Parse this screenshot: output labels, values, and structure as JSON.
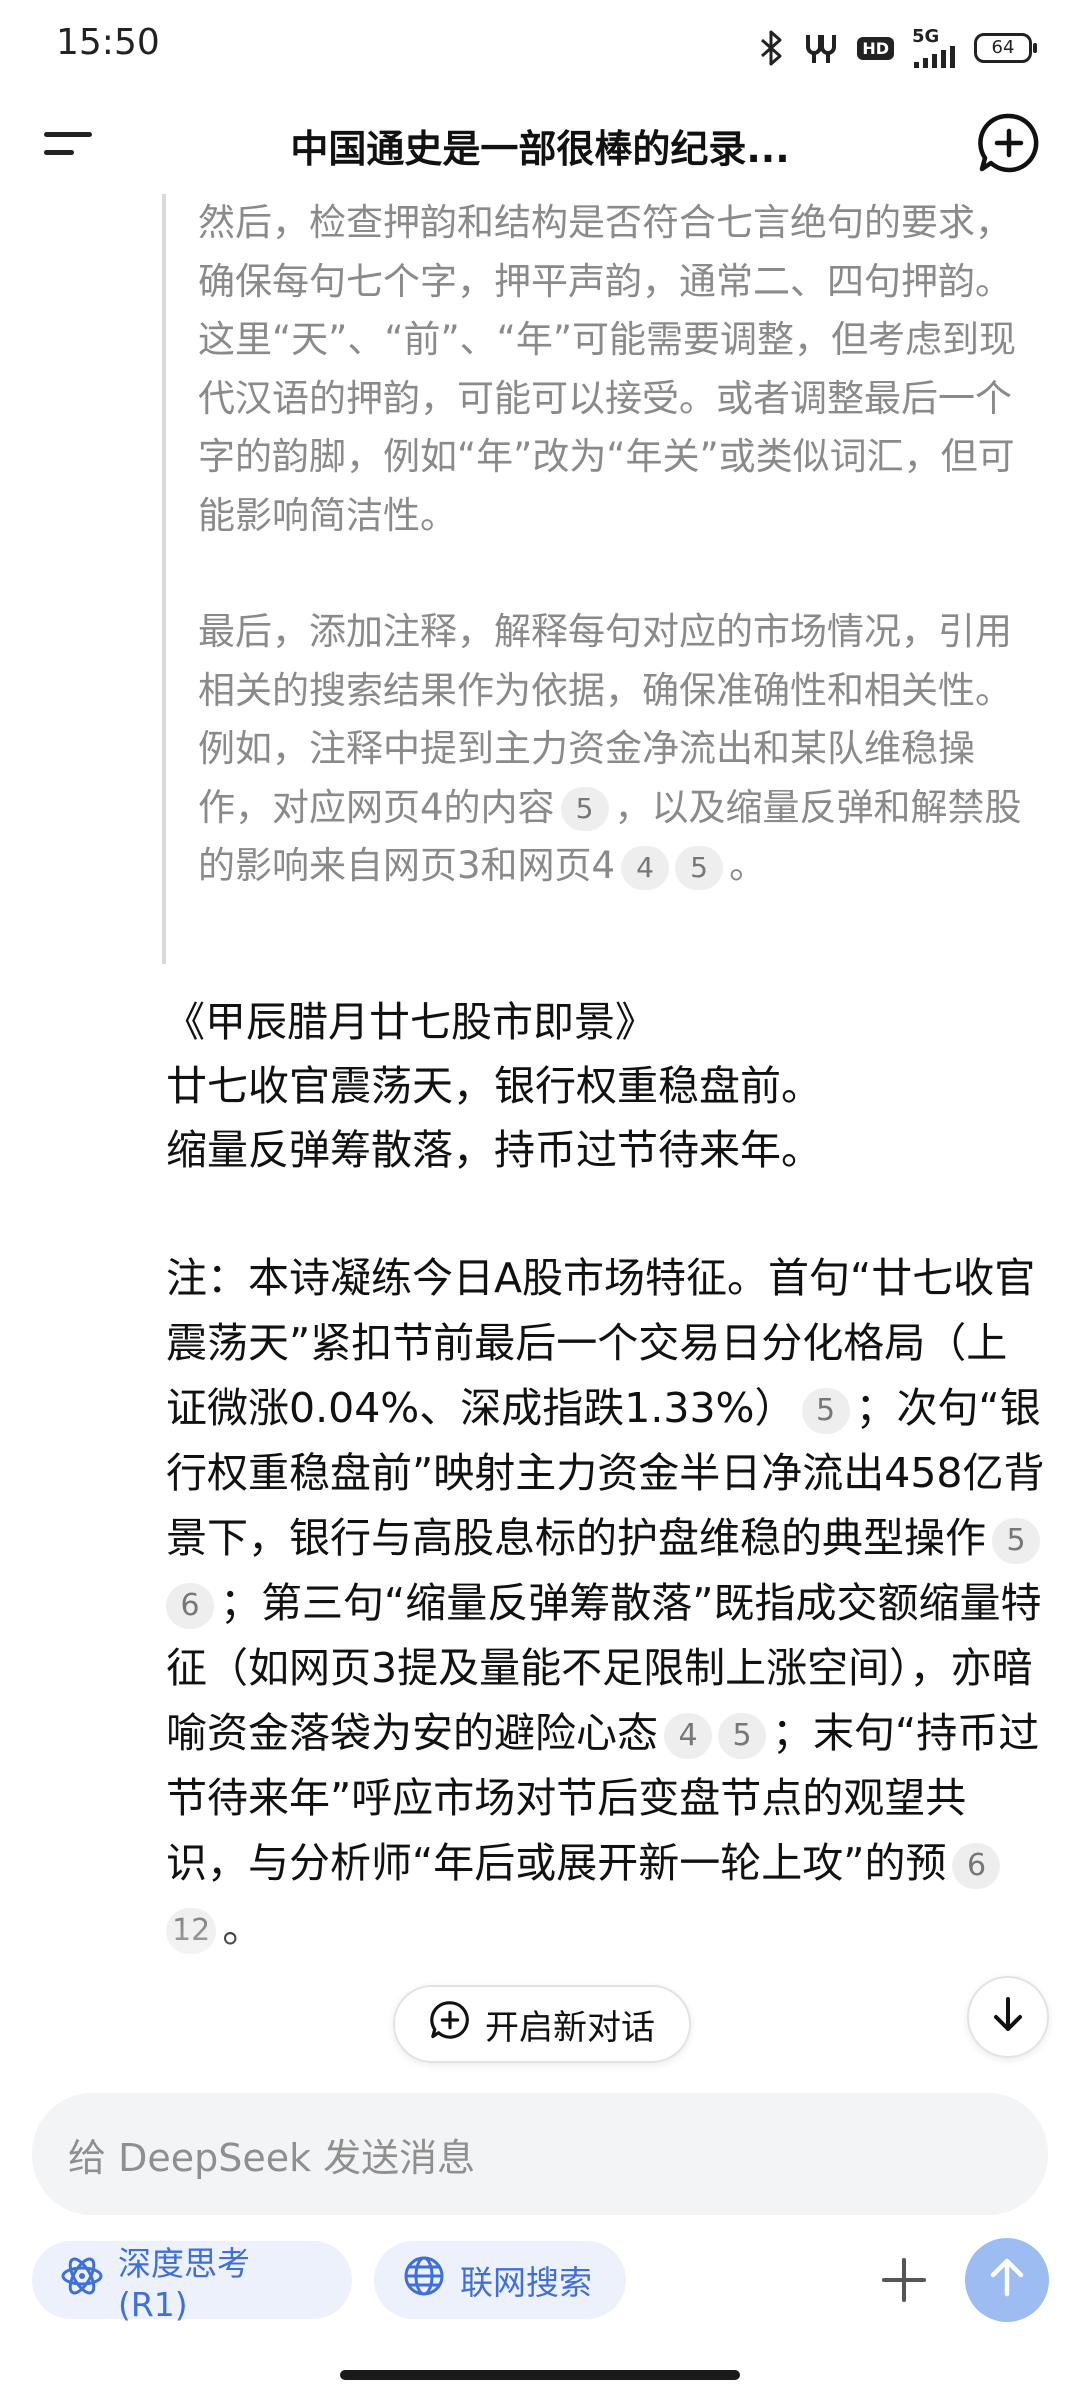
{
  "status_bar": {
    "time": "15:50",
    "hd_label": "HD",
    "network_label": "5G",
    "battery_level": "64",
    "icons": [
      "bluetooth-icon",
      "signal-sound-icon",
      "hd-icon",
      "cellular-signal-icon",
      "battery-icon"
    ]
  },
  "header": {
    "title": "中国通史是一部很棒的纪录...",
    "menu_icon": "menu-icon",
    "new_chat_icon": "add-chat-icon"
  },
  "thinking": {
    "p1": "然后，检查押韵和结构是否符合七言绝句的要求，确保每句七个字，押平声韵，通常二、四句押韵。这里“天”、“前”、“年”可能需要调整，但考虑到现代汉语的押韵，可能可以接受。或者调整最后一个字的韵脚，例如“年”改为“年关”或类似词汇，但可能影响简洁性。",
    "p2_a": "最后，添加注释，解释每句对应的市场情况，引用相关的搜索结果作为依据，确保准确性和相关性。例如，注释中提到主力资金净流出和某队维稳操作，对应网页4的内容",
    "p2_cite1": "5",
    "p2_b": "，以及缩量反弹和解禁股的影响来自网页3和网页4",
    "p2_cite2": "4",
    "p2_cite3": "5",
    "p2_c": "。"
  },
  "answer": {
    "poem_title": "《甲辰腊月廿七股市即景》",
    "line1": "廿七收官震荡天，银行权重稳盘前。",
    "line2": "缩量反弹筹散落，持币过节待来年。",
    "note_a": "注：本诗凝练今日A股市场特征。首句“廿七收官震荡天”紧扣节前最后一个交易日分化格局（上证微涨0.04%、深成指跌1.33%）",
    "cite_a": "5",
    "note_b": "；次句“银行权重稳盘前”映射主力资金半日净流出458亿背景下，银行与高股息标的护盘维稳的典型操作",
    "cite_b1": "5",
    "cite_b2": "6",
    "note_c": "；第三句“缩量反弹筹散落”既指成交额缩量特征（如网页3提及量能不足限制上涨空间），亦暗喻资金落袋为安的避险心态",
    "cite_c1": "4",
    "cite_c2": "5",
    "note_d": "；末句“持币过节待来年”呼应市场对节后变盘节点的观望共识，与分析师“年后或展开新一轮上攻”的预",
    "cite_d1": "6",
    "cite_d2": "12",
    "note_e": "。"
  },
  "floating": {
    "new_chat_label": "开启新对话",
    "new_chat_icon": "add-chat-icon",
    "scroll_icon": "arrow-down-icon"
  },
  "composer": {
    "placeholder": "给 DeepSeek 发送消息",
    "deep_think_label": "深度思考 (R1)",
    "deep_think_icon": "atom-icon",
    "web_search_label": "联网搜索",
    "web_search_icon": "globe-icon",
    "attach_icon": "plus-icon",
    "send_icon": "arrow-up-icon"
  },
  "colors": {
    "accent": "#3f6fd8",
    "chip_bg": "#edf1fb",
    "send_disabled": "#9cbcf2",
    "thinking_text": "#8a8a8a"
  }
}
